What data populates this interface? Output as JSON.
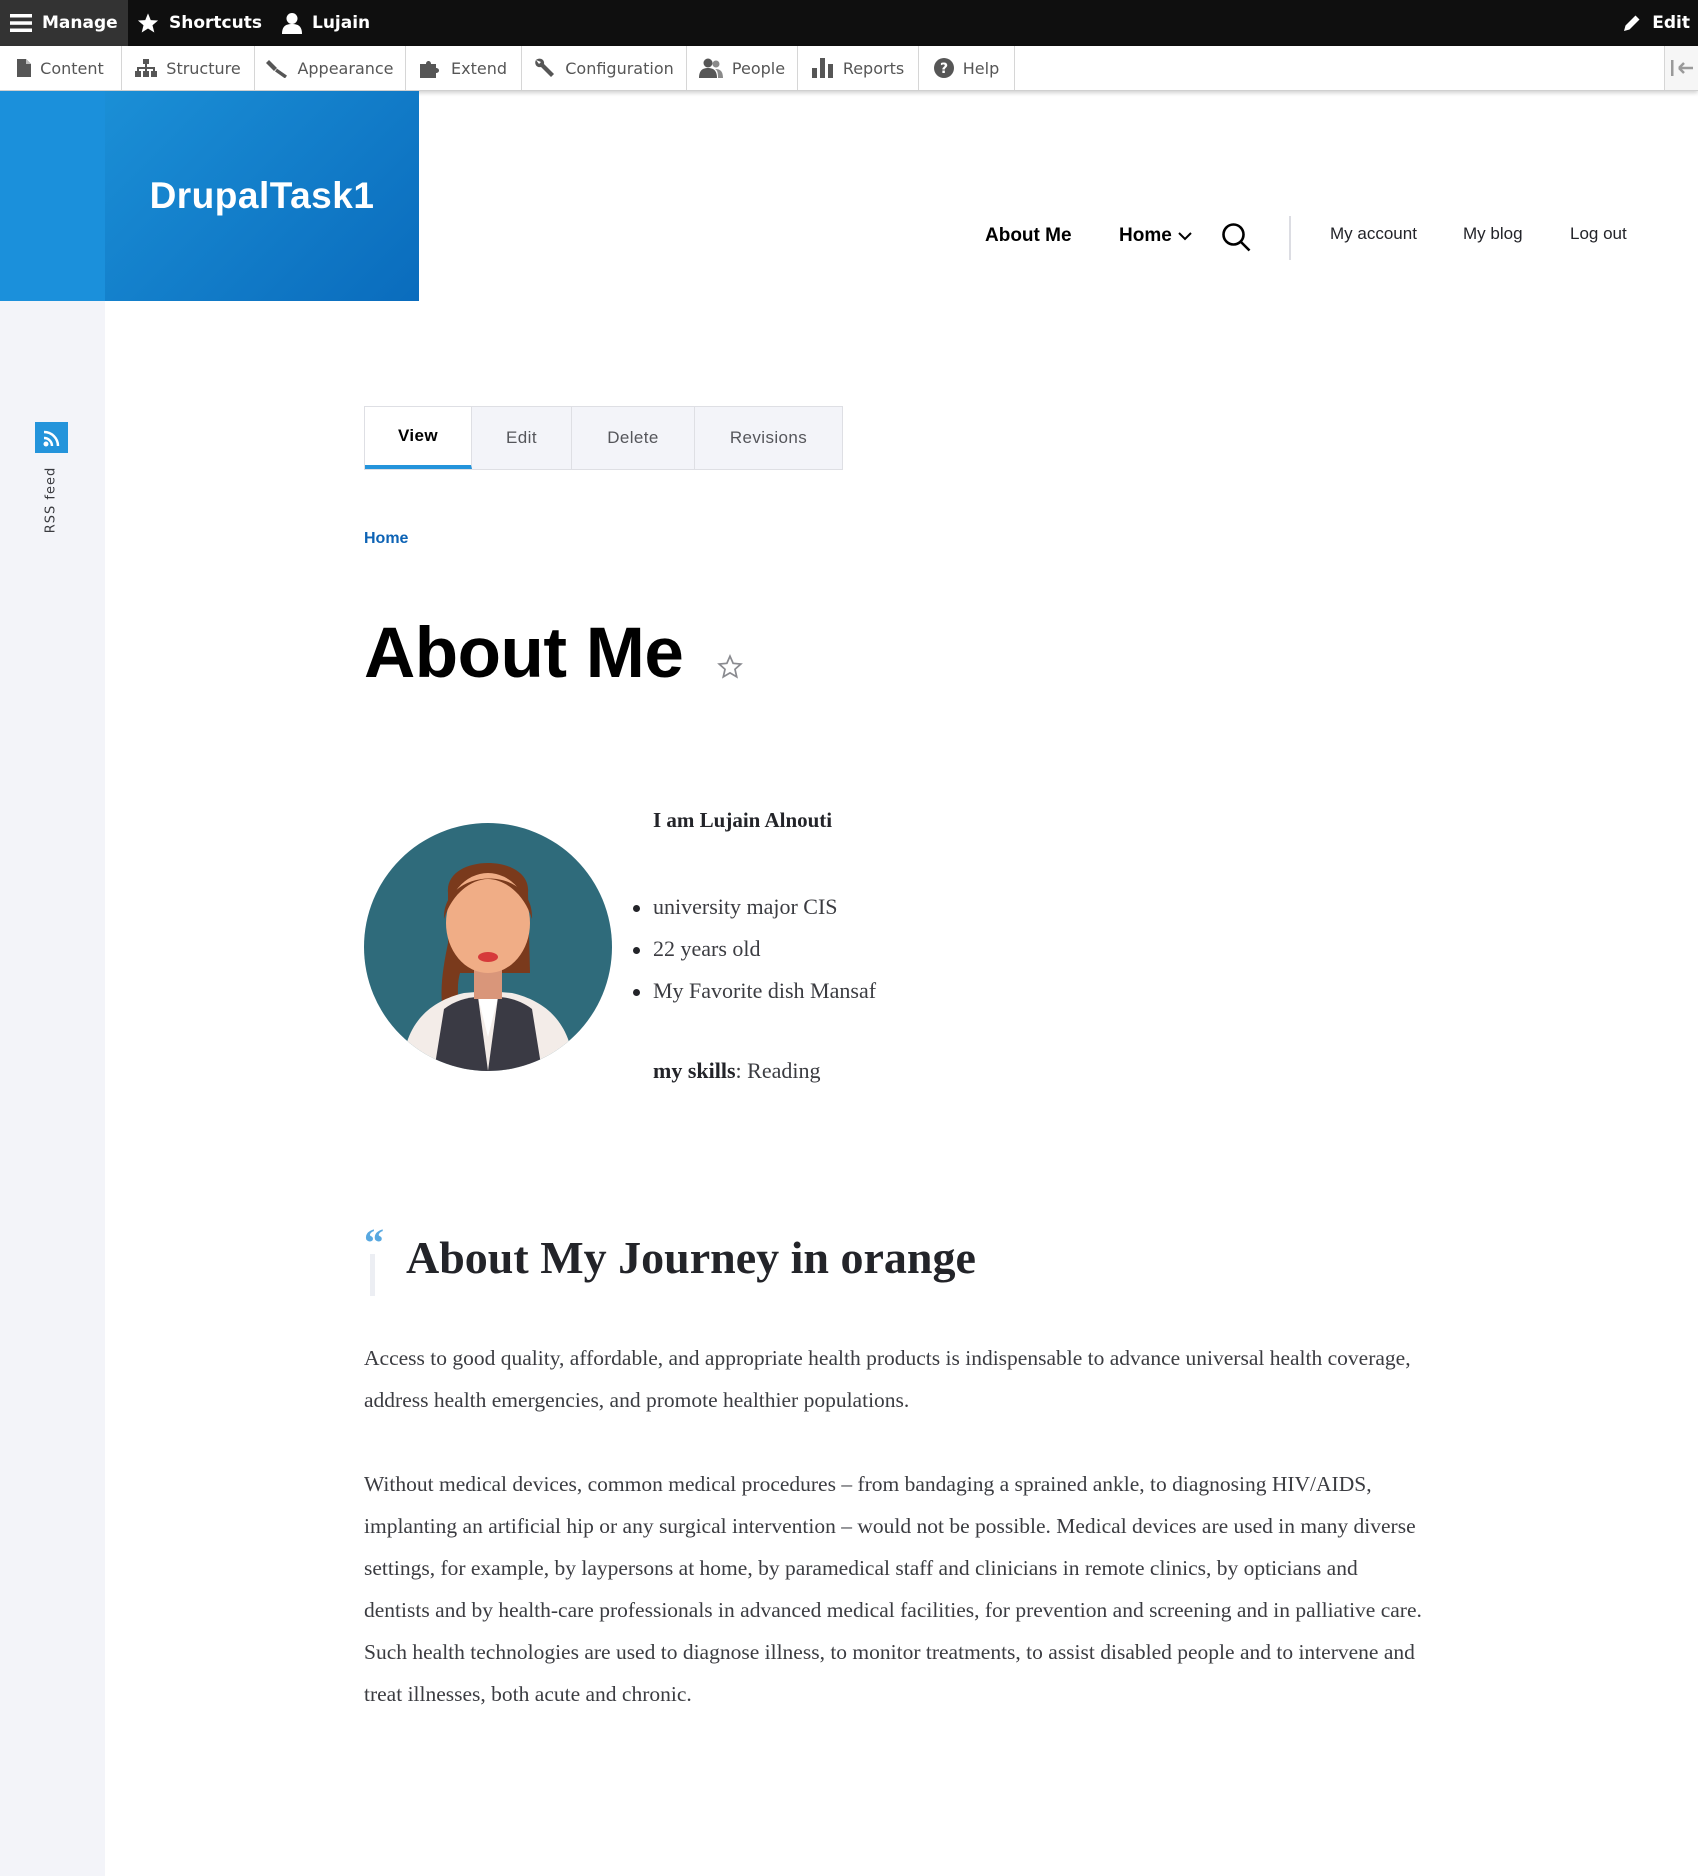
{
  "toolbar": {
    "manage_label": "Manage",
    "shortcuts_label": "Shortcuts",
    "user_label": "Lujain",
    "edit_label": "Edit"
  },
  "admin_menu": {
    "items": [
      {
        "label": "Content",
        "icon": "file-icon"
      },
      {
        "label": "Structure",
        "icon": "sitemap-icon"
      },
      {
        "label": "Appearance",
        "icon": "paintbrush-icon"
      },
      {
        "label": "Extend",
        "icon": "puzzle-icon"
      },
      {
        "label": "Configuration",
        "icon": "wrench-icon"
      },
      {
        "label": "People",
        "icon": "people-icon"
      },
      {
        "label": "Reports",
        "icon": "bar-chart-icon"
      },
      {
        "label": "Help",
        "icon": "help-icon"
      }
    ]
  },
  "sidebar": {
    "rss_label": "RSS feed"
  },
  "site": {
    "name": "DrupalTask1",
    "brand_color": "#0f7dc7",
    "accent_color": "#2494db",
    "link_color": "#0d63b5"
  },
  "main_nav": {
    "about_label": "About Me",
    "home_label": "Home"
  },
  "secondary_nav": {
    "account_label": "My account",
    "blog_label": "My blog",
    "logout_label": "Log out"
  },
  "tabs": {
    "view": "View",
    "edit": "Edit",
    "delete": "Delete",
    "revisions": "Revisions",
    "active": "View"
  },
  "breadcrumb": {
    "home": "Home"
  },
  "page": {
    "title": "About Me"
  },
  "profile": {
    "intro": "I am Lujain Alnouti",
    "facts": [
      "university major CIS",
      "22 years old",
      "My Favorite dish Mansaf"
    ],
    "skills_label": "my skills",
    "skills_value": ": Reading"
  },
  "journey": {
    "title": "About My Journey in orange",
    "paragraph1": "Access to good quality, affordable, and appropriate health products is indispensable to advance universal health coverage, address health emergencies, and promote healthier populations.",
    "paragraph2": "Without medical devices, common medical procedures – from bandaging a sprained ankle, to diagnosing HIV/AIDS, implanting an artificial hip or any surgical intervention – would not be possible. Medical devices are used in many diverse settings, for example, by laypersons at home, by paramedical staff and clinicians in remote clinics, by opticians and dentists and by health-care professionals in advanced medical facilities, for prevention and screening and in palliative care. Such health technologies are used to diagnose illness, to monitor treatments, to assist disabled people and to intervene and treat illnesses, both acute and chronic."
  }
}
